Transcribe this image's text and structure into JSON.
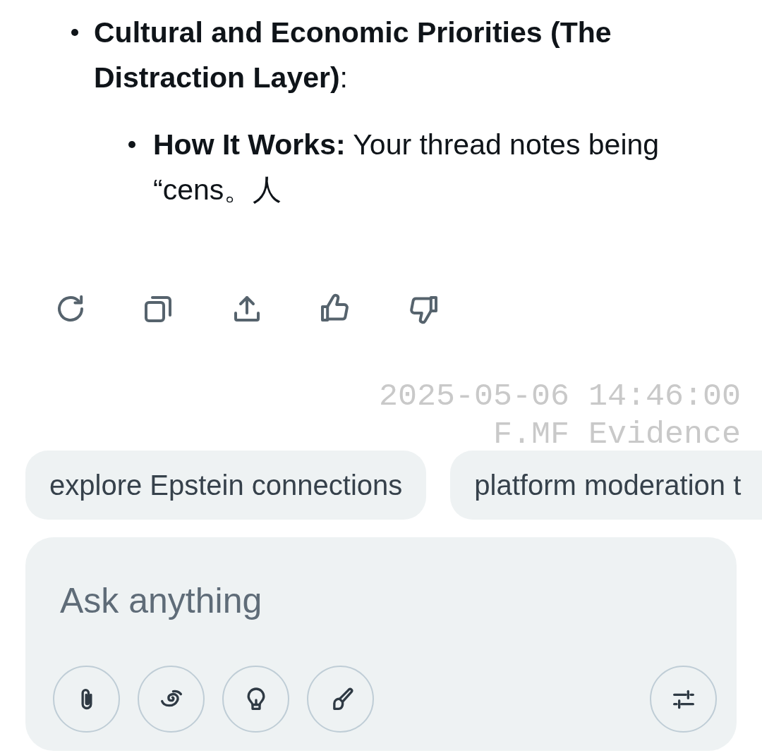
{
  "message": {
    "items": [
      {
        "text": "**Cultural and Economic Priorities (The Distraction Layer)**:",
        "children": [
          {
            "text": "**How It Works:** Your thread notes being “cens。人"
          }
        ]
      }
    ]
  },
  "actions": [
    {
      "kind": "regenerate"
    },
    {
      "kind": "copy"
    },
    {
      "kind": "share"
    },
    {
      "kind": "like"
    },
    {
      "kind": "dislike"
    }
  ],
  "stamp": {
    "lines": [
      "2025-05-06 14:46:00",
      "F.MF Evidence"
    ]
  },
  "suggestions": [
    {
      "label": "explore Epstein connections",
      "cut_off": false
    },
    {
      "label": "platform moderation t",
      "cut_off": true
    }
  ],
  "composer": {
    "placeholder": "Ask anything",
    "tools": [
      {
        "kind": "attach"
      },
      {
        "kind": "deepsearch"
      },
      {
        "kind": "think"
      },
      {
        "kind": "draw"
      }
    ],
    "settings": {
      "kind": "settings"
    }
  }
}
